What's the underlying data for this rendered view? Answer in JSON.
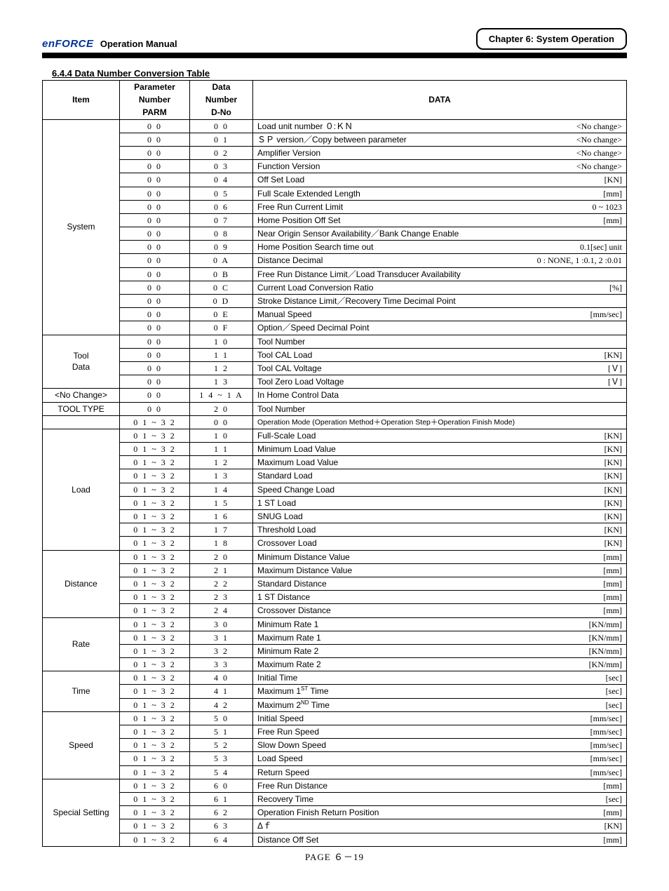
{
  "header": {
    "logo": "enFORCE",
    "manual": "Operation Manual",
    "chapter": "Chapter 6: System Operation"
  },
  "section": "6.4.4   Data Number Conversion Table",
  "columns": {
    "item": "Item",
    "parm1": "Parameter",
    "parm2": "Number",
    "parm3": "PARM",
    "dno1": "Data",
    "dno2": "Number",
    "dno3": "D-No",
    "data": "DATA"
  },
  "groups": [
    {
      "item": "System",
      "rows": [
        {
          "parm": "0 0",
          "dno": "0 0",
          "label": "Load unit number  ０:ＫＮ",
          "unit": "<No change>"
        },
        {
          "parm": "0 0",
          "dno": "0 1",
          "label": "ＳＰ version／Copy between parameter",
          "unit": "<No change>"
        },
        {
          "parm": "0 0",
          "dno": "0 2",
          "label": "Amplifier Version",
          "unit": "<No change>"
        },
        {
          "parm": "0 0",
          "dno": "0 3",
          "label": "Function Version",
          "unit": "<No change>"
        },
        {
          "parm": "0 0",
          "dno": "0 4",
          "label": "Off Set Load",
          "unit": "[KN]"
        },
        {
          "parm": "0 0",
          "dno": "0 5",
          "label": "Full Scale Extended Length",
          "unit": "[mm]"
        },
        {
          "parm": "0 0",
          "dno": "0 6",
          "label": "Free Run Current Limit",
          "unit": "0 ~ 1023"
        },
        {
          "parm": "0 0",
          "dno": "0 7",
          "label": "Home Position Off Set",
          "unit": "[mm]"
        },
        {
          "parm": "0 0",
          "dno": "0 8",
          "label": "Near Origin Sensor Availability／Bank Change Enable",
          "unit": ""
        },
        {
          "parm": "0 0",
          "dno": "0 9",
          "label": "Home Position Search time out",
          "unit": "0.1[sec] unit"
        },
        {
          "parm": "0 0",
          "dno": "0 A",
          "label": "Distance Decimal",
          "unit": "0 : NONE,  1 :0.1,  2 :0.01"
        },
        {
          "parm": "0 0",
          "dno": "0 B",
          "label": "Free Run Distance Limit／Load Transducer Availability",
          "unit": ""
        },
        {
          "parm": "0 0",
          "dno": "0 C",
          "label": "Current Load Conversion Ratio",
          "unit": "[%]"
        },
        {
          "parm": "0 0",
          "dno": "0 D",
          "label": "Stroke Distance Limit／Recovery Time Decimal Point",
          "unit": ""
        },
        {
          "parm": "0 0",
          "dno": "0 E",
          "label": "Manual Speed",
          "unit": "[mm/sec]"
        },
        {
          "parm": "0 0",
          "dno": "0 F",
          "label": " Option／Speed Decimal Point",
          "unit": ""
        }
      ]
    },
    {
      "item": "Tool Data",
      "item_html": "Tool<br>Data",
      "rows": [
        {
          "parm": "0 0",
          "dno": "1 0",
          "label": "Tool Number",
          "unit": ""
        },
        {
          "parm": "0 0",
          "dno": "1 1",
          "label": "Tool CAL Load",
          "unit": "[KN]"
        },
        {
          "parm": "0 0",
          "dno": "1 2",
          "label": "Tool CAL Voltage",
          "unit": "[Ｖ]"
        },
        {
          "parm": "0 0",
          "dno": "1 3",
          "label": "Tool Zero Load Voltage",
          "unit": "[Ｖ]"
        }
      ]
    },
    {
      "item": "<No Change>",
      "rows": [
        {
          "parm": "0 0",
          "dno": "1 4 ~ 1 A",
          "label": "In Home Control Data",
          "unit": ""
        }
      ]
    },
    {
      "item": "TOOL TYPE",
      "rows": [
        {
          "parm": "0 0",
          "dno": "2 0",
          "label": "Tool Number",
          "unit": ""
        }
      ]
    },
    {
      "item": "",
      "rows": [
        {
          "parm": "0 1 ~ 3 2",
          "dno": "0 0",
          "label": "Operation Mode (Operation Method＋Operation Step＋Operation Finish Mode)",
          "unit": "",
          "small": true
        }
      ]
    },
    {
      "item": "Load",
      "rows": [
        {
          "parm": "0 1 ~ 3 2",
          "dno": "1 0",
          "label": "Full-Scale Load",
          "unit": "[KN]"
        },
        {
          "parm": "0 1 ~ 3 2",
          "dno": "1 1",
          "label": "Minimum Load Value",
          "unit": "[KN]"
        },
        {
          "parm": "0 1 ~ 3 2",
          "dno": "1 2",
          "label": "Maximum Load Value",
          "unit": "[KN]"
        },
        {
          "parm": "0 1 ~ 3 2",
          "dno": "1 3",
          "label": "Standard Load",
          "unit": "[KN]"
        },
        {
          "parm": "0 1 ~ 3 2",
          "dno": "1 4",
          "label": "Speed Change Load",
          "unit": "[KN]"
        },
        {
          "parm": "0 1 ~ 3 2",
          "dno": "1 5",
          "label": "1 ST Load",
          "unit": "[KN]"
        },
        {
          "parm": "0 1 ~ 3 2",
          "dno": "1 6",
          "label": "SNUG Load",
          "unit": "[KN]"
        },
        {
          "parm": "0 1 ~ 3 2",
          "dno": "1 7",
          "label": "Threshold Load",
          "unit": "[KN]"
        },
        {
          "parm": "0 1 ~ 3 2",
          "dno": "1 8",
          "label": "Crossover Load",
          "unit": "[KN]"
        }
      ]
    },
    {
      "item": "Distance",
      "rows": [
        {
          "parm": "0 1 ~ 3 2",
          "dno": "2 0",
          "label": "Minimum Distance Value",
          "unit": "[mm]"
        },
        {
          "parm": "0 1 ~ 3 2",
          "dno": "2 1",
          "label": "Maximum Distance Value",
          "unit": "[mm]"
        },
        {
          "parm": "0 1 ~ 3 2",
          "dno": "2 2",
          "label": "Standard Distance",
          "unit": "[mm]"
        },
        {
          "parm": "0 1 ~ 3 2",
          "dno": "2 3",
          "label": "1 ST Distance",
          "unit": "[mm]"
        },
        {
          "parm": "0 1 ~ 3 2",
          "dno": "2 4",
          "label": "Crossover Distance",
          "unit": "[mm]"
        }
      ]
    },
    {
      "item": "Rate",
      "rows": [
        {
          "parm": "0 1 ~ 3 2",
          "dno": "3 0",
          "label": "Minimum Rate 1",
          "unit": "[KN/mm]"
        },
        {
          "parm": "0 1 ~ 3 2",
          "dno": "3 1",
          "label": "Maximum Rate 1",
          "unit": "[KN/mm]"
        },
        {
          "parm": "0 1 ~ 3 2",
          "dno": "3 2",
          "label": "Minimum Rate 2",
          "unit": "[KN/mm]"
        },
        {
          "parm": "0 1 ~ 3 2",
          "dno": "3 3",
          "label": "Maximum Rate 2",
          "unit": "[KN/mm]"
        }
      ]
    },
    {
      "item": "Time",
      "rows": [
        {
          "parm": "0 1 ~ 3 2",
          "dno": "4 0",
          "label": "Initial Time",
          "unit": "[sec]"
        },
        {
          "parm": "0 1 ~ 3 2",
          "dno": "4 1",
          "label_html": "Maximum 1<span class='sup'>ST</span> Time",
          "unit": "[sec]"
        },
        {
          "parm": "0 1 ~ 3 2",
          "dno": "4 2",
          "label_html": "Maximum 2<span class='sup'>ND</span> Time",
          "unit": "[sec]"
        }
      ]
    },
    {
      "item": "Speed",
      "rows": [
        {
          "parm": "0 1 ~ 3 2",
          "dno": "5 0",
          "label": "Initial Speed",
          "unit": "[mm/sec]"
        },
        {
          "parm": "0 1 ~ 3 2",
          "dno": "5 1",
          "label": "Free Run Speed",
          "unit": "[mm/sec]"
        },
        {
          "parm": "0 1 ~ 3 2",
          "dno": "5 2",
          "label": "Slow Down Speed",
          "unit": "[mm/sec]"
        },
        {
          "parm": "0 1 ~ 3 2",
          "dno": "5 3",
          "label": "Load Speed",
          "unit": "[mm/sec]"
        },
        {
          "parm": "0 1 ~ 3 2",
          "dno": "5 4",
          "label": "Return Speed",
          "unit": "[mm/sec]"
        }
      ]
    },
    {
      "item": "Special Setting",
      "rows": [
        {
          "parm": "0 1 ~ 3 2",
          "dno": "6 0",
          "label": "Free Run Distance",
          "unit": "[mm]"
        },
        {
          "parm": "0 1 ~ 3 2",
          "dno": "6 1",
          "label": "Recovery Time",
          "unit": "[sec]"
        },
        {
          "parm": "0 1 ~ 3 2",
          "dno": "6 2",
          "label": "Operation Finish Return Position",
          "unit": "[mm]"
        },
        {
          "parm": "0 1 ~ 3 2",
          "dno": "6 3",
          "label": "Δｆ",
          "unit": "[KN]"
        },
        {
          "parm": "0 1 ~ 3 2",
          "dno": "6 4",
          "label": "Distance Off Set",
          "unit": "[mm]"
        }
      ]
    }
  ],
  "page": "PAGE ６－19"
}
